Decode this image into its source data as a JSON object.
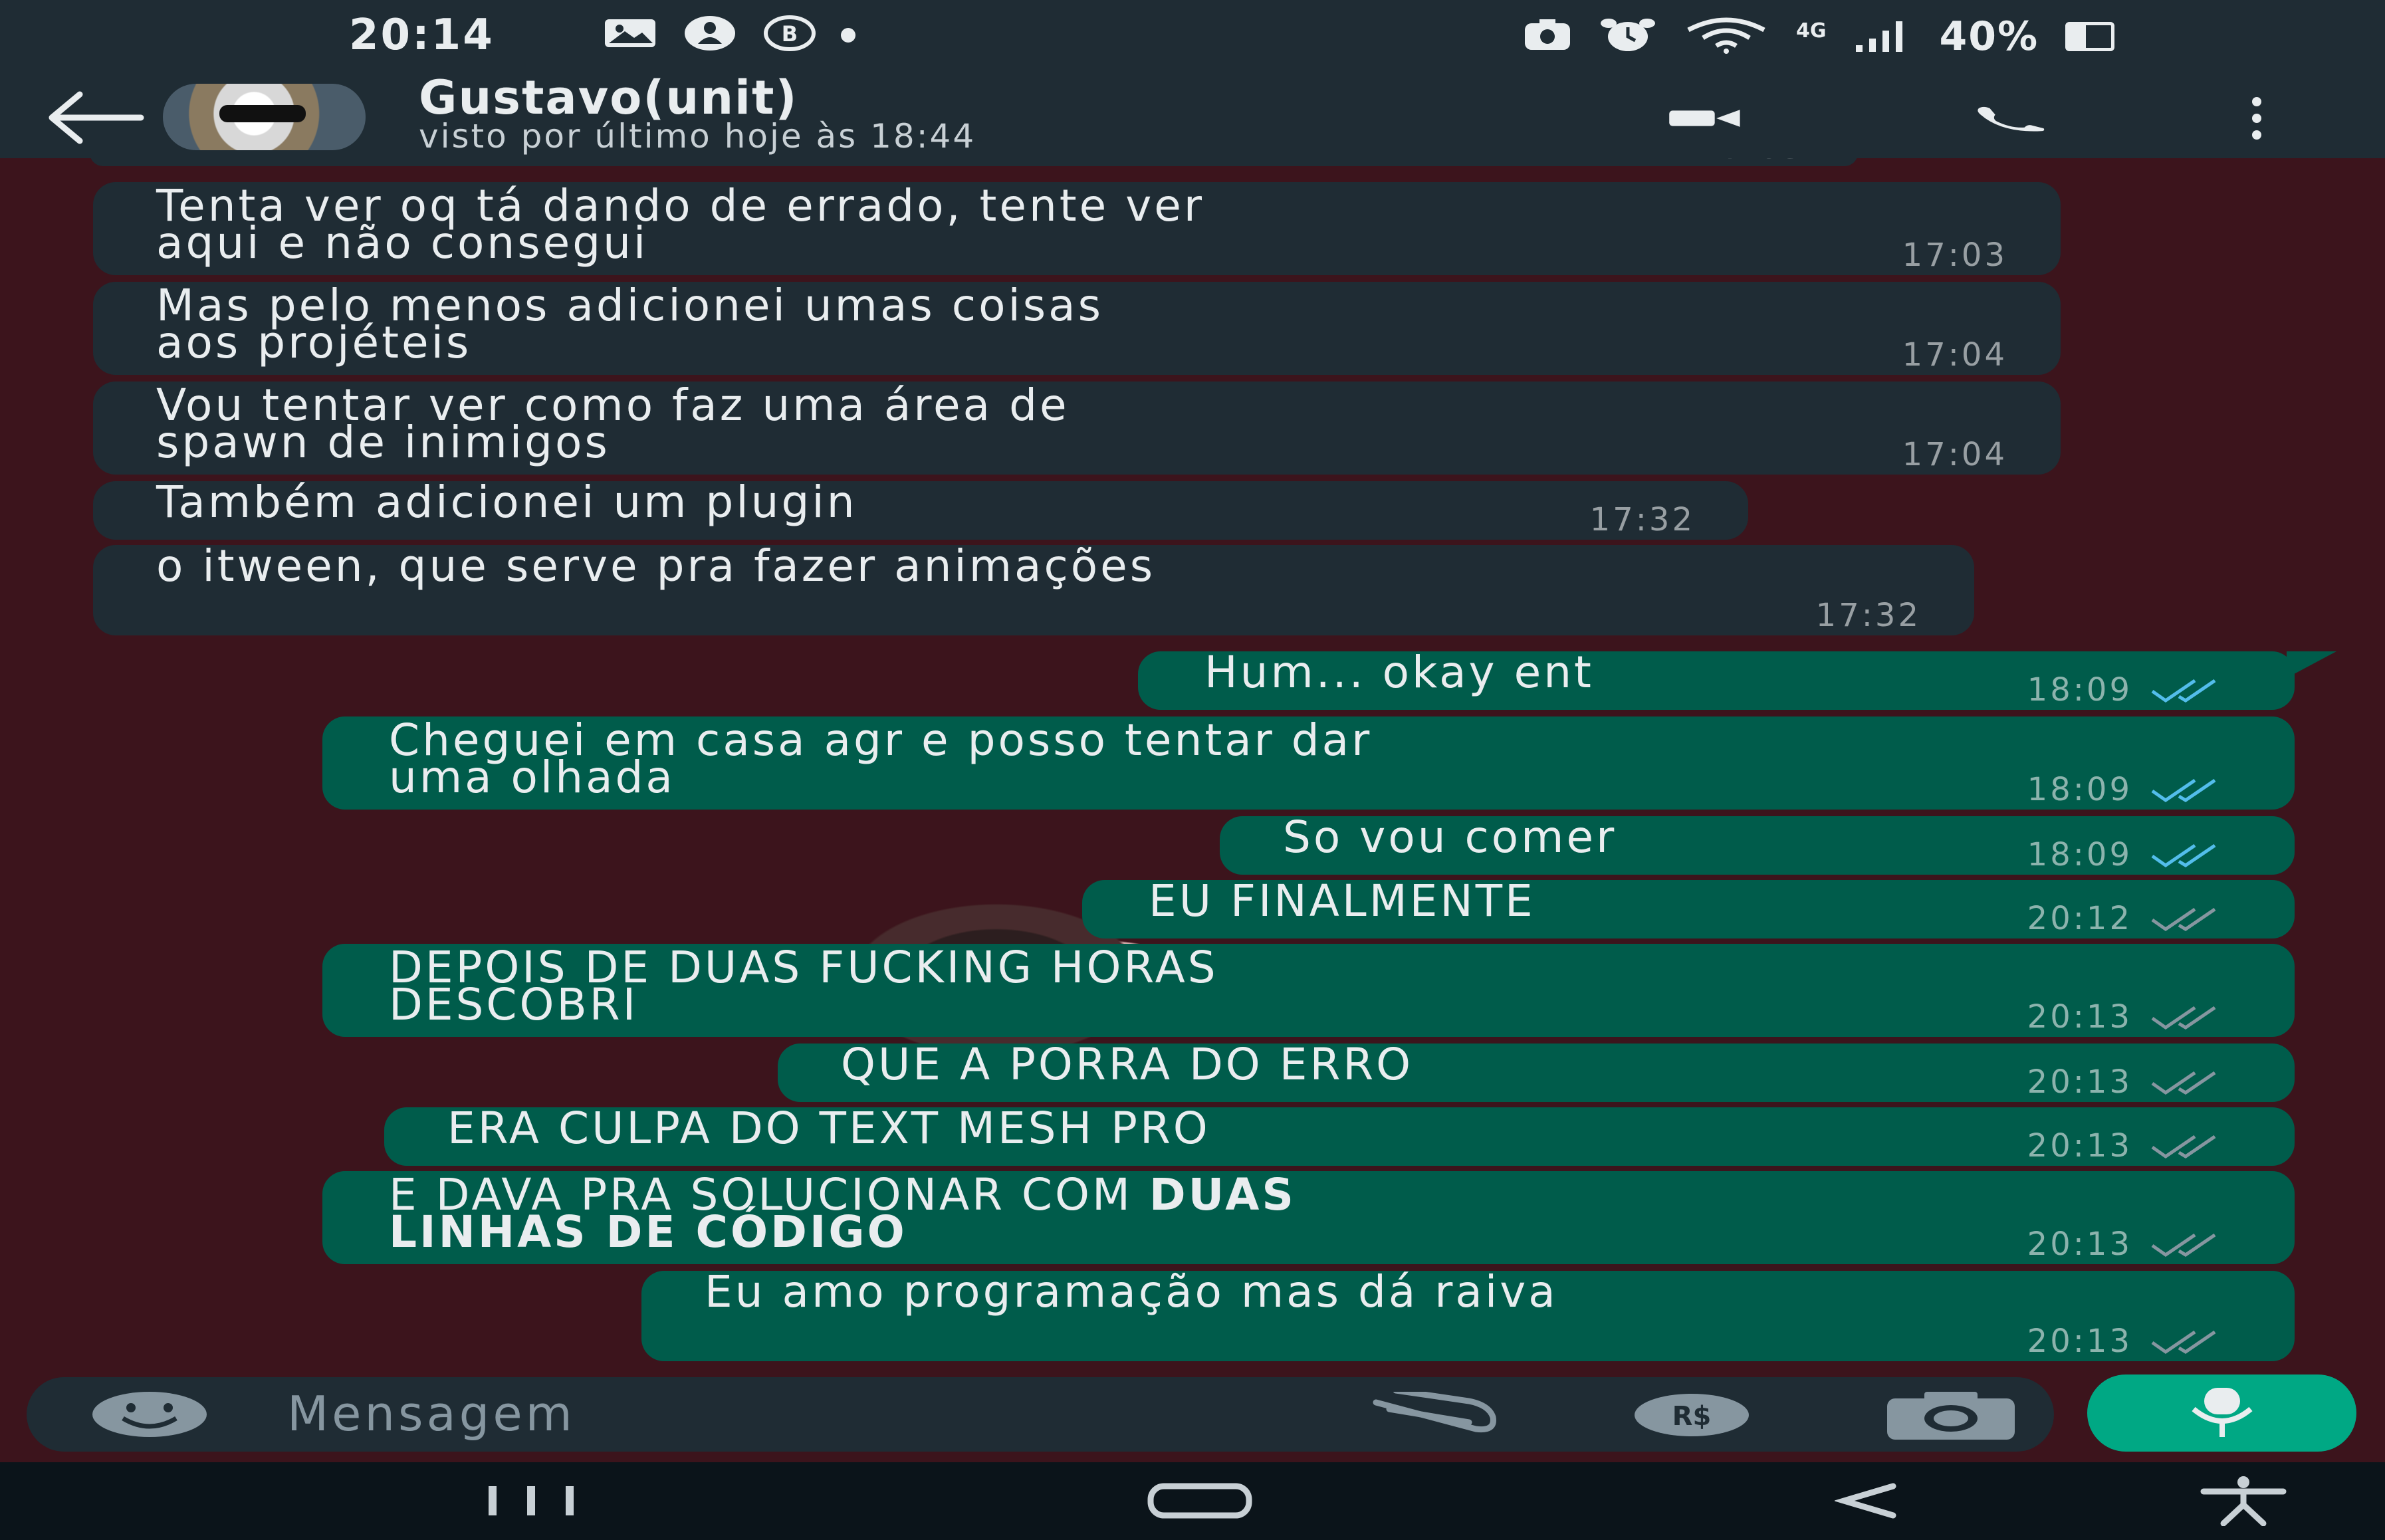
{
  "status_bar": {
    "time": "20:14",
    "battery_percent": "40%",
    "battery_level": 0.4,
    "network_label": "4G",
    "left_icons": [
      "image-notification-icon",
      "contacts-notification-icon",
      "b-badge-icon",
      "dot-icon"
    ],
    "right_icons": [
      "screenshot-icon",
      "alarm-icon",
      "wifi-icon",
      "signal-icon",
      "battery-icon"
    ]
  },
  "header": {
    "contact_name": "Gustavo(unit)",
    "last_seen": "visto por último hoje às 18:44",
    "icons": [
      "back-arrow-icon",
      "video-call-icon",
      "phone-call-icon",
      "kebab-menu-icon"
    ]
  },
  "messages": [
    {
      "dir": "in",
      "text": "Tenta ver oq tá dando de errado, tente ver\naqui e não consegui",
      "time": "17:03"
    },
    {
      "dir": "in",
      "text": "Mas pelo menos adicionei umas coisas\naos projéteis",
      "time": "17:04"
    },
    {
      "dir": "in",
      "text": "Vou tentar ver como faz uma área de\nspawn de inimigos",
      "time": "17:04"
    },
    {
      "dir": "in",
      "text": "Também adicionei um plugin",
      "time": "17:32"
    },
    {
      "dir": "in",
      "text": "o itween, que serve pra fazer animações",
      "time": "17:32"
    },
    {
      "dir": "out",
      "text": "Hum... okay ent",
      "time": "18:09",
      "status": "read"
    },
    {
      "dir": "out",
      "text": "Cheguei em casa agr e posso tentar dar\numa olhada",
      "time": "18:09",
      "status": "read"
    },
    {
      "dir": "out",
      "text": "So vou comer",
      "time": "18:09",
      "status": "read"
    },
    {
      "dir": "out",
      "text": "EU FINALMENTE",
      "time": "20:12",
      "status": "delivered"
    },
    {
      "dir": "out",
      "text": "DEPOIS DE DUAS FUCKING HORAS\nDESCOBRI",
      "time": "20:13",
      "status": "delivered"
    },
    {
      "dir": "out",
      "text": "QUE A PORRA DO ERRO",
      "time": "20:13",
      "status": "delivered"
    },
    {
      "dir": "out",
      "text": "ERA CULPA DO TEXT MESH PRO",
      "time": "20:13",
      "status": "delivered"
    },
    {
      "dir": "out",
      "text_plain": "E DAVA PRA SOLUCIONAR COM ",
      "text_bold_1": "DUAS",
      "text_bold_2": "LINHAS DE CÓDIGO",
      "time": "20:13",
      "status": "delivered"
    },
    {
      "dir": "out",
      "text": "Eu amo programação mas dá raiva",
      "time": "20:13",
      "status": "delivered"
    }
  ],
  "input_bar": {
    "placeholder": "Mensagem",
    "icons": [
      "emoji-icon",
      "attach-icon",
      "payment-icon",
      "camera-icon",
      "microphone-icon"
    ]
  },
  "nav_bar": {
    "icons": [
      "recent-apps-icon",
      "home-icon",
      "back-nav-icon",
      "accessibility-icon"
    ]
  },
  "colors": {
    "chat_background": "#3c141c",
    "incoming_bubble": "#1f2c34",
    "outgoing_bubble": "#005c4b",
    "read_ticks": "#53bdeb",
    "delivered_ticks": "#8696a0",
    "mic_button": "#00a884"
  }
}
